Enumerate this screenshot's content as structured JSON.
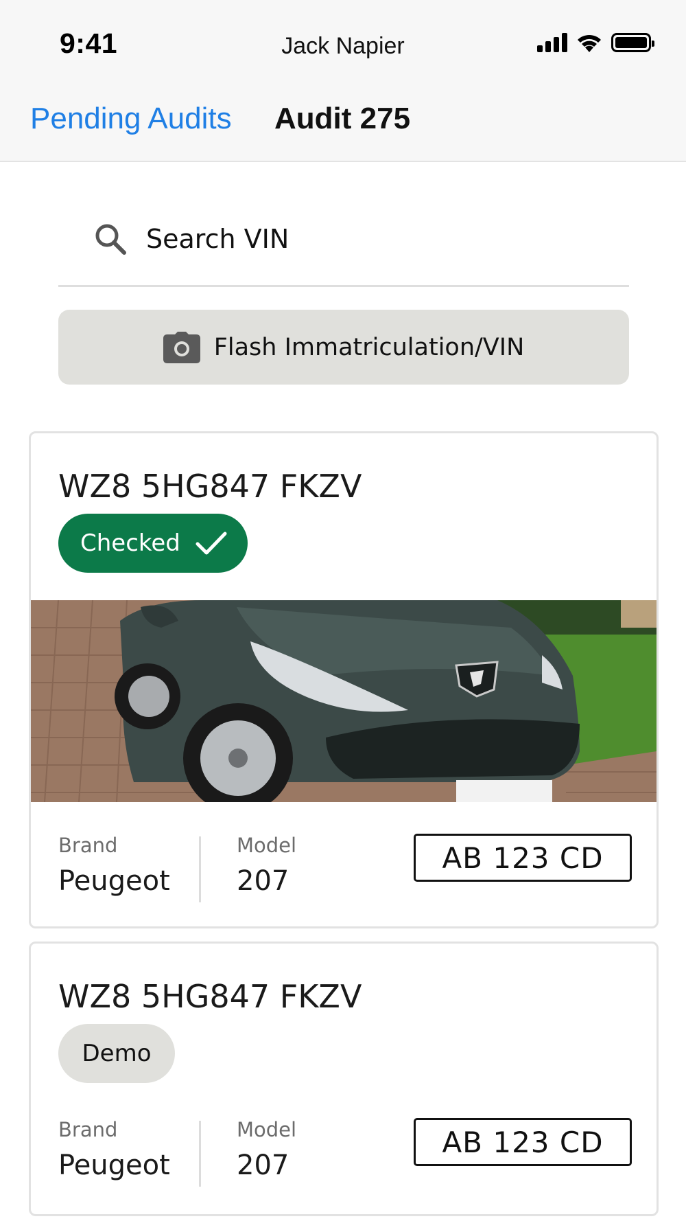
{
  "status_bar": {
    "time": "9:41",
    "user_name": "Jack Napier",
    "icons": [
      "cellular-signal-icon",
      "wifi-icon",
      "battery-icon"
    ]
  },
  "nav": {
    "back_label": "Pending Audits",
    "title": "Audit 275"
  },
  "search": {
    "placeholder": "Search VIN",
    "value": ""
  },
  "flash_button": {
    "label": "Flash Immatriculation/VIN",
    "icon": "camera-icon"
  },
  "colors": {
    "accent_blue": "#1f7fe5",
    "checked_green": "#0c7a49",
    "neutral_badge": "#e0e0dc"
  },
  "vehicles": [
    {
      "vin": "WZ8 5HG847 FKZV",
      "status": "Checked",
      "status_icon": "checkmark-icon",
      "has_photo": true,
      "brand_label": "Brand",
      "brand": "Peugeot",
      "model_label": "Model",
      "model": "207",
      "plate": "AB 123 CD"
    },
    {
      "vin": "WZ8 5HG847 FKZV",
      "status": "Demo",
      "has_photo": false,
      "brand_label": "Brand",
      "brand": "Peugeot",
      "model_label": "Model",
      "model": "207",
      "plate": "AB 123 CD"
    }
  ]
}
